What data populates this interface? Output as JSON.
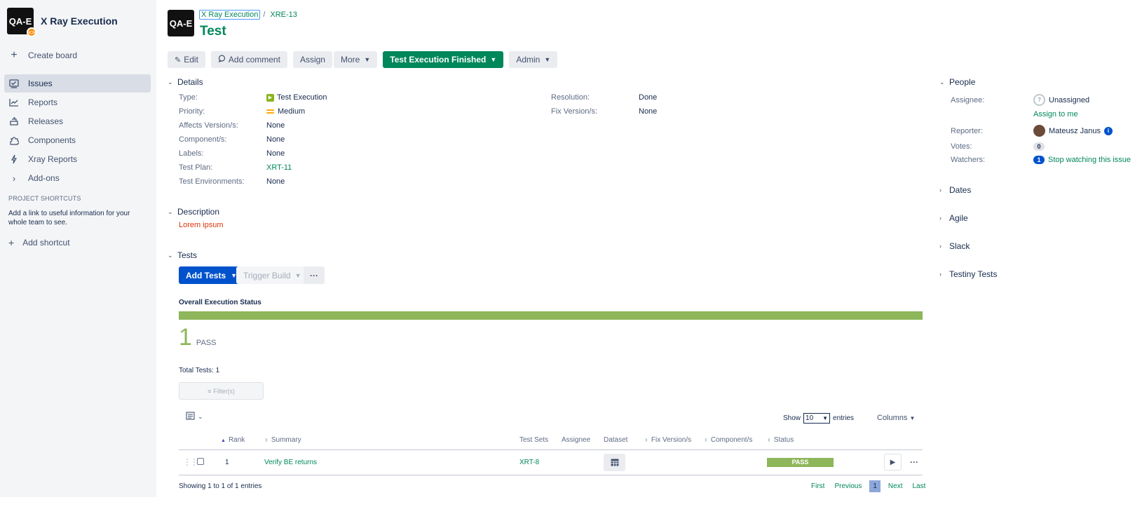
{
  "sidebar": {
    "project_name": "X Ray Execution",
    "project_logo_text": "QA-E",
    "items": [
      {
        "label": "Create board",
        "icon": "plus-icon"
      },
      {
        "label": "Issues",
        "icon": "issues-icon",
        "active": true
      },
      {
        "label": "Reports",
        "icon": "reports-icon"
      },
      {
        "label": "Releases",
        "icon": "releases-icon"
      },
      {
        "label": "Components",
        "icon": "components-icon"
      },
      {
        "label": "Xray Reports",
        "icon": "bolt-icon"
      },
      {
        "label": "Add-ons",
        "icon": "chevron-right-icon"
      }
    ],
    "shortcuts_header": "PROJECT SHORTCUTS",
    "shortcuts_text": "Add a link to useful information for your whole team to see.",
    "add_shortcut": "Add shortcut"
  },
  "header": {
    "avatar_text": "QA-E",
    "breadcrumb_project": "X Ray Execution",
    "breadcrumb_sep": "/",
    "breadcrumb_key": "XRE-13",
    "title": "Test"
  },
  "toolbar": {
    "edit": "Edit",
    "add_comment": "Add comment",
    "assign": "Assign",
    "more": "More",
    "status": "Test Execution Finished",
    "admin": "Admin"
  },
  "details": {
    "heading": "Details",
    "left": [
      {
        "label": "Type:",
        "value": "Test Execution"
      },
      {
        "label": "Priority:",
        "value": "Medium"
      },
      {
        "label": "Affects Version/s:",
        "value": "None"
      },
      {
        "label": "Component/s:",
        "value": "None"
      },
      {
        "label": "Labels:",
        "value": "None"
      },
      {
        "label": "Test Plan:",
        "value": "XRT-11"
      },
      {
        "label": "Test Environments:",
        "value": "None"
      }
    ],
    "right": [
      {
        "label": "Resolution:",
        "value": "Done"
      },
      {
        "label": "Fix Version/s:",
        "value": "None"
      }
    ]
  },
  "description": {
    "heading": "Description",
    "text": "Lorem ipsum"
  },
  "tests": {
    "heading": "Tests",
    "add_tests": "Add Tests",
    "trigger_build": "Trigger Build",
    "overall_status_label": "Overall Execution Status",
    "pass_fraction": 1.0,
    "pass_count": "1",
    "pass_label": "PASS",
    "total_tests": "Total Tests: 1",
    "filter_placeholder": "Filter(s)",
    "show_label": "Show",
    "show_value": "10",
    "entries_label": "entries",
    "columns_button": "Columns",
    "columns": [
      "Rank",
      "Summary",
      "Test Sets",
      "Assignee",
      "Dataset",
      "Fix Version/s",
      "Component/s",
      "Status"
    ],
    "rows": [
      {
        "rank": "1",
        "summary": "Verify BE returns",
        "test_sets": "XRT-8",
        "assignee": "",
        "fix_versions": "",
        "components": "",
        "status": "PASS"
      }
    ],
    "showing": "Showing 1 to 1 of 1 entries",
    "pager": {
      "first": "First",
      "previous": "Previous",
      "current": "1",
      "next": "Next",
      "last": "Last"
    }
  },
  "people": {
    "heading": "People",
    "assignee_label": "Assignee:",
    "assignee_value": "Unassigned",
    "assign_to_me": "Assign to me",
    "reporter_label": "Reporter:",
    "reporter_value": "Mateusz Janus",
    "votes_label": "Votes:",
    "votes_count": "0",
    "watchers_label": "Watchers:",
    "watchers_count": "1",
    "watch_link": "Stop watching this issue"
  },
  "side_sections": [
    "Dates",
    "Agile",
    "Slack",
    "Testiny Tests"
  ],
  "colors": {
    "accent_green": "#00875a",
    "primary_blue": "#0052cc",
    "pass_green": "#8eb65a",
    "description_red": "#de350b"
  }
}
